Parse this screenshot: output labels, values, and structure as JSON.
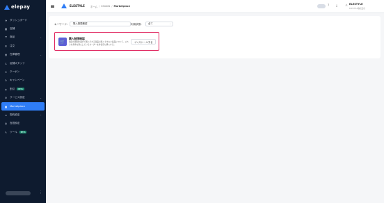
{
  "brand": {
    "name": "elepay",
    "accent": "#2f7df6"
  },
  "sidebar": {
    "items": [
      {
        "label": "ダッシュボード",
        "icon": "dashboard-icon",
        "glyph": "◔"
      },
      {
        "label": "店舗",
        "icon": "store-icon",
        "glyph": "▦"
      },
      {
        "label": "商品",
        "icon": "tag-icon",
        "glyph": "⛉",
        "chevron": "⌄"
      },
      {
        "label": "注文",
        "icon": "order-icon",
        "glyph": "☰"
      },
      {
        "label": "在庫管理",
        "icon": "inventory-icon",
        "glyph": "▤",
        "chevron": "⌄"
      },
      {
        "label": "店舗スタッフ",
        "icon": "staff-icon",
        "glyph": "♙"
      },
      {
        "label": "クーポン",
        "icon": "coupon-icon",
        "glyph": "⊙"
      },
      {
        "label": "キャンペーン",
        "icon": "campaign-icon",
        "glyph": "↻"
      },
      {
        "label": "割引",
        "icon": "discount-icon",
        "glyph": "◈",
        "badge": "BETA"
      },
      {
        "label": "サービス設定",
        "icon": "service-settings-icon",
        "glyph": "⚙",
        "chevron": "⌄"
      },
      {
        "label": "Marketplace",
        "icon": "marketplace-icon",
        "glyph": "▦",
        "active": true
      },
      {
        "label": "契約設定",
        "icon": "contract-icon",
        "glyph": "▭",
        "chevron": "⌄"
      },
      {
        "label": "言語設定",
        "icon": "language-icon",
        "glyph": "◍"
      },
      {
        "label": "ツール",
        "icon": "tool-icon",
        "glyph": "✎",
        "badge": "BETA"
      }
    ],
    "account_menu_glyph": "⋮"
  },
  "header": {
    "org_name": "ELESTYLE",
    "breadcrumbs": [
      "ホーム",
      "ChinChi",
      "Marketplace"
    ],
    "separator": "/",
    "help_glyph": "?",
    "download_glyph": "⤓",
    "user_glyph": "♙",
    "user_name": "ELESTYLE",
    "user_sub": "ELESTYLE株式会社"
  },
  "filters": {
    "keyword_label": "キーワード:",
    "keyword_value": "購入制限確認",
    "status_label": "利用状態:",
    "status_value": "全て",
    "status_arrow": "⌄"
  },
  "card": {
    "icon_glyph": "🛒",
    "title": "購入制限確認",
    "description": "指定の期間を過ぎて購入できる商品と購入できない商品について、これらの条件を満たしているオーダーを非表示に購入する。",
    "button_label": "インストールする",
    "highlight_color": "#e0245e"
  }
}
